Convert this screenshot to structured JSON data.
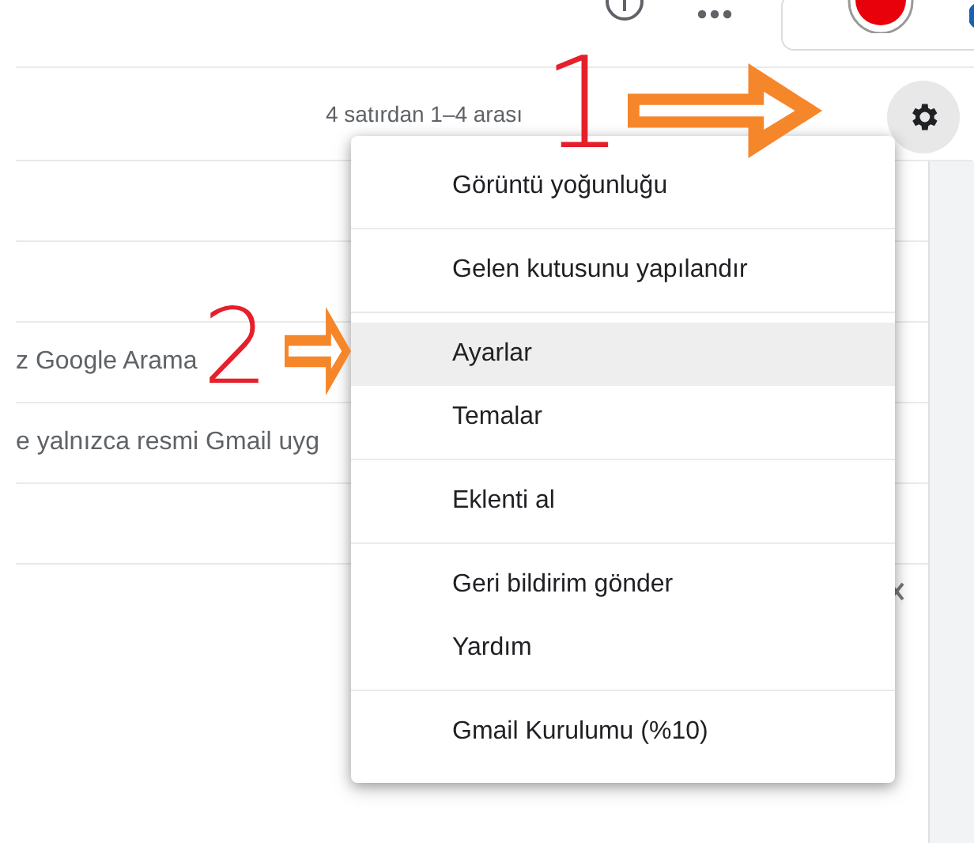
{
  "toolbar": {
    "count": "4 satırdan 1–4 arası"
  },
  "rows": [
    {
      "snippet": ""
    },
    {
      "snippet": ""
    },
    {
      "snippet": "z Google Arama"
    },
    {
      "snippet": "e yalnızca resmi Gmail uyg"
    },
    {
      "snippet": ""
    }
  ],
  "menu": {
    "sections": [
      {
        "items": [
          {
            "label": "Görüntü yoğunluğu",
            "highlighted": false
          }
        ]
      },
      {
        "items": [
          {
            "label": "Gelen kutusunu yapılandır",
            "highlighted": false
          }
        ]
      },
      {
        "items": [
          {
            "label": "Ayarlar",
            "highlighted": true
          },
          {
            "label": "Temalar",
            "highlighted": false
          }
        ]
      },
      {
        "items": [
          {
            "label": "Eklenti al",
            "highlighted": false
          }
        ]
      },
      {
        "items": [
          {
            "label": "Geri bildirim gönder",
            "highlighted": false
          },
          {
            "label": "Yardım",
            "highlighted": false
          }
        ]
      },
      {
        "items": [
          {
            "label": "Gmail Kurulumu (%10)",
            "highlighted": false
          }
        ]
      }
    ]
  },
  "annotations": [
    {
      "label": "1"
    },
    {
      "label": "2"
    }
  ]
}
